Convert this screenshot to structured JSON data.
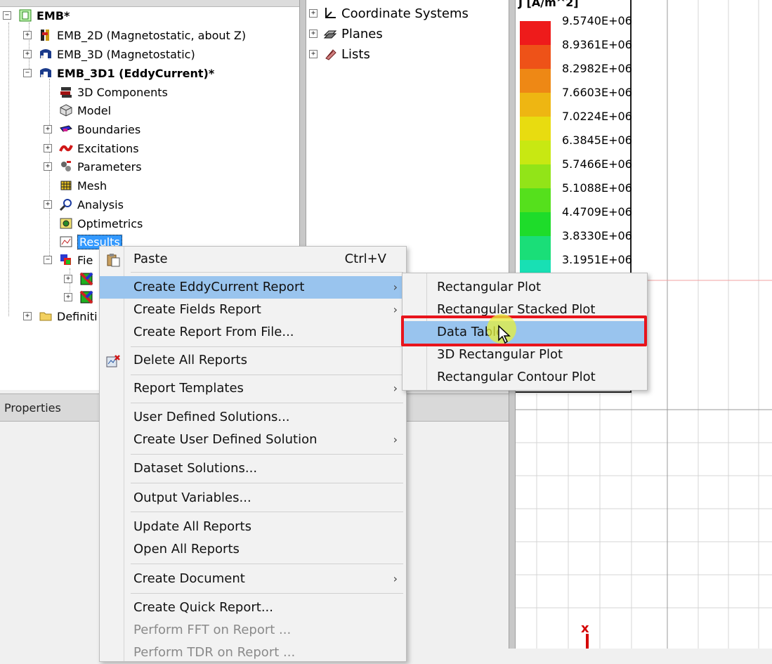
{
  "tree": {
    "root": {
      "label": "EMB*"
    },
    "designs": [
      {
        "label": "EMB_2D (Magnetostatic, about Z)"
      },
      {
        "label": "EMB_3D (Magnetostatic)"
      },
      {
        "label": "EMB_3D1 (EddyCurrent)*"
      }
    ],
    "items": [
      {
        "label": "3D Components"
      },
      {
        "label": "Model"
      },
      {
        "label": "Boundaries"
      },
      {
        "label": "Excitations"
      },
      {
        "label": "Parameters"
      },
      {
        "label": "Mesh"
      },
      {
        "label": "Analysis"
      },
      {
        "label": "Optimetrics"
      },
      {
        "label": "Results"
      },
      {
        "label": "Fie"
      }
    ],
    "definitions": {
      "label": "Definiti"
    }
  },
  "mid": {
    "items": [
      {
        "label": "Coordinate Systems"
      },
      {
        "label": "Planes"
      },
      {
        "label": "Lists"
      }
    ]
  },
  "properties": {
    "title": "Properties"
  },
  "legend": {
    "title": "J [A/m^2]",
    "entries": [
      {
        "value": "9.5740E+06",
        "color": "#ee1b1b"
      },
      {
        "value": "8.9361E+06",
        "color": "#ee5218"
      },
      {
        "value": "8.2982E+06",
        "color": "#ee8815"
      },
      {
        "value": "7.6603E+06",
        "color": "#eeb612"
      },
      {
        "value": "7.0224E+06",
        "color": "#e8dc10"
      },
      {
        "value": "6.3845E+06",
        "color": "#c8e812"
      },
      {
        "value": "5.7466E+06",
        "color": "#92e418"
      },
      {
        "value": "5.1088E+06",
        "color": "#55e01c"
      },
      {
        "value": "4.4709E+06",
        "color": "#1edc2a"
      },
      {
        "value": "3.8330E+06",
        "color": "#1ade78"
      },
      {
        "value": "3.1951E+06",
        "color": "#18e0b4"
      },
      {
        "value": "",
        "color": "#18e8e0"
      }
    ]
  },
  "viewport": {
    "axis_x": "x"
  },
  "context_menu": {
    "paste": {
      "label": "Paste",
      "shortcut": "Ctrl+V"
    },
    "create_eddy_report": {
      "label": "Create EddyCurrent Report"
    },
    "create_fields_report": {
      "label": "Create Fields Report"
    },
    "create_report_from_file": {
      "label": "Create Report From File..."
    },
    "delete_all_reports": {
      "label": "Delete All Reports"
    },
    "report_templates": {
      "label": "Report Templates"
    },
    "user_defined_solutions": {
      "label": "User Defined Solutions..."
    },
    "create_user_defined_solution": {
      "label": "Create User Defined Solution"
    },
    "dataset_solutions": {
      "label": "Dataset Solutions..."
    },
    "output_variables": {
      "label": "Output Variables..."
    },
    "update_all_reports": {
      "label": "Update All Reports"
    },
    "open_all_reports": {
      "label": "Open All Reports"
    },
    "create_document": {
      "label": "Create Document"
    },
    "create_quick_report": {
      "label": "Create Quick Report..."
    },
    "perform_fft": {
      "label": "Perform FFT on Report ..."
    },
    "perform_tdr": {
      "label": "Perform TDR on Report ..."
    }
  },
  "submenu": {
    "rectangular_plot": "Rectangular Plot",
    "rectangular_stacked_plot": "Rectangular Stacked Plot",
    "data_table": "Data Table",
    "rectangular_3d_plot": "3D Rectangular Plot",
    "rectangular_contour_plot": "Rectangular Contour Plot"
  }
}
